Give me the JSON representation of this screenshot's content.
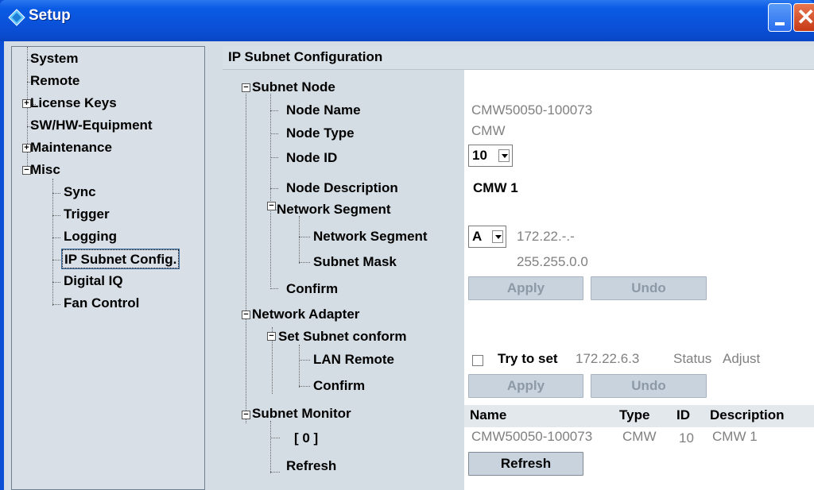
{
  "window": {
    "title": "Setup"
  },
  "tree": {
    "items": [
      {
        "label": "System"
      },
      {
        "label": "Remote"
      },
      {
        "label": "License Keys"
      },
      {
        "label": "SW/HW-Equipment"
      },
      {
        "label": "Maintenance"
      },
      {
        "label": "Misc"
      },
      {
        "label": "Sync"
      },
      {
        "label": "Trigger"
      },
      {
        "label": "Logging"
      },
      {
        "label": "IP Subnet Config."
      },
      {
        "label": "Digital IQ"
      },
      {
        "label": "Fan Control"
      }
    ],
    "selected": "IP Subnet Config."
  },
  "main": {
    "header": "IP Subnet Configuration",
    "labels": {
      "subnet_node": "Subnet Node",
      "node_name": "Node Name",
      "node_type": "Node Type",
      "node_id": "Node ID",
      "node_description": "Node Description",
      "network_segment_group": "Network Segment",
      "network_segment": "Network Segment",
      "subnet_mask": "Subnet Mask",
      "confirm_1": "Confirm",
      "network_adapter": "Network Adapter",
      "set_subnet_conform": "Set Subnet conform",
      "lan_remote": "LAN Remote",
      "confirm_2": "Confirm",
      "subnet_monitor": "Subnet Monitor",
      "monitor_item": "[ 0 ]",
      "refresh": "Refresh"
    },
    "values": {
      "node_name": "CMW50050-100073",
      "node_type": "CMW",
      "node_id": "10",
      "node_description": "CMW 1",
      "segment_letter": "A",
      "segment_ip": "172.22.-.-",
      "subnet_mask": "255.255.0.0",
      "apply_label": "Apply",
      "undo_label": "Undo",
      "try_to_set_label": "Try to set",
      "try_to_set_ip": "172.22.6.3",
      "status_label": "Status",
      "status_value": "Adjust",
      "refresh_button": "Refresh"
    },
    "monitor_table": {
      "columns": [
        "Name",
        "Type",
        "ID",
        "Description"
      ],
      "rows": [
        [
          "CMW50050-100073",
          "CMW",
          "10",
          "CMW 1"
        ]
      ]
    }
  },
  "colors": {
    "titlebar": "#0a4fd6",
    "panel": "#d5dde4",
    "selection_outline": "#3a6ea5"
  }
}
